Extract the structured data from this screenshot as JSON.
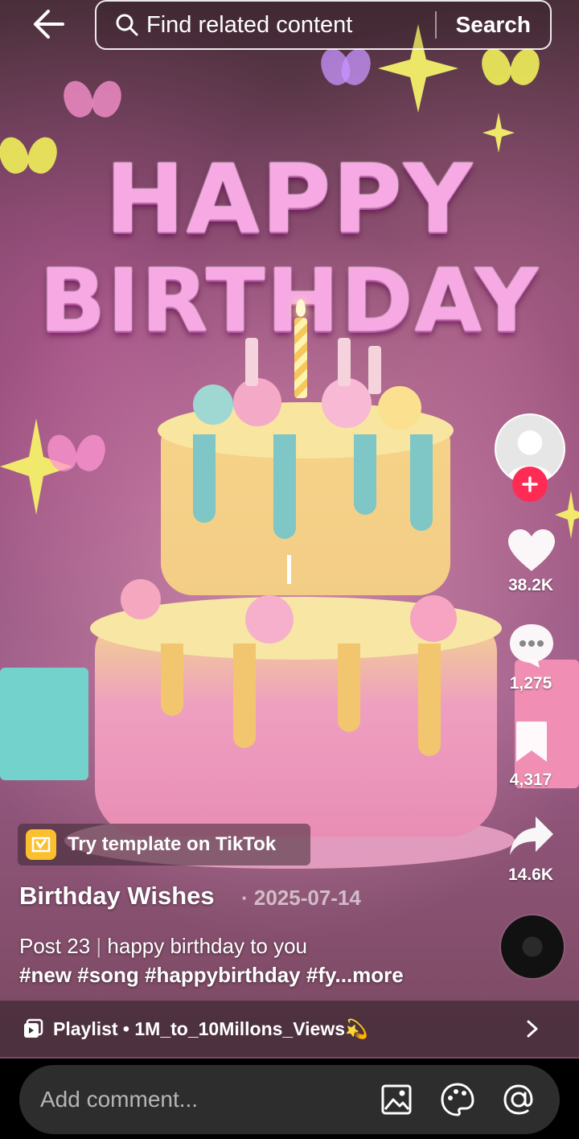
{
  "header": {
    "back_icon": "arrow-left-icon",
    "search_placeholder": "Find related content",
    "search_button": "Search",
    "search_icon": "search-icon"
  },
  "video": {
    "headline_line1": "HAPPY",
    "headline_line2": "BIRTHDAY"
  },
  "actions": {
    "likes": "38.2K",
    "comments": "1,275",
    "saves": "4,317",
    "shares": "14.6K",
    "follow_color": "#fe2c55"
  },
  "template": {
    "label": "Try template on TikTok",
    "icon": "capcut-template-icon",
    "color": "#fbc02d"
  },
  "post": {
    "author": "Birthday Wishes",
    "date": "· 2025-07-14",
    "caption_prefix": "Post 23",
    "caption_sep": "|",
    "caption_text": "happy birthday to you",
    "hashtags": "#new #song #happybirthday #fy",
    "more_label": "...more"
  },
  "playlist": {
    "label": "Playlist • 1M_to_10Millons_Views💫"
  },
  "comment_bar": {
    "placeholder": "Add comment...",
    "tools": [
      "image-icon",
      "emoji-icon",
      "mention-icon"
    ]
  }
}
